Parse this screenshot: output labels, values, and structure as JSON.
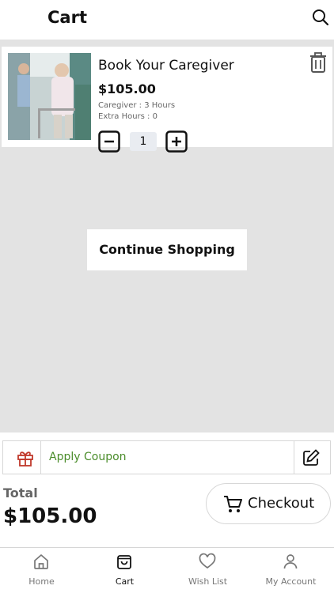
{
  "header": {
    "title": "Cart"
  },
  "cart": {
    "items": [
      {
        "name": "Book Your Caregiver",
        "price": "$105.00",
        "caregiver": "Caregiver : 3 Hours",
        "extra_hours": "Extra Hours : 0",
        "quantity": "1"
      }
    ]
  },
  "continue_label": "Continue Shopping",
  "coupon": {
    "label": "Apply Coupon"
  },
  "summary": {
    "total_label": "Total",
    "total_value": "$105.00"
  },
  "checkout_label": "Checkout",
  "nav": {
    "items": [
      {
        "label": "Home",
        "icon": "home-icon"
      },
      {
        "label": "Cart",
        "icon": "bag-icon"
      },
      {
        "label": "Wish List",
        "icon": "heart-icon"
      },
      {
        "label": "My Account",
        "icon": "user-icon"
      }
    ],
    "active": "Cart"
  },
  "colors": {
    "coupon_text": "#4a8c2a",
    "gift_icon": "#c0392b",
    "background": "#e3e3e3"
  }
}
